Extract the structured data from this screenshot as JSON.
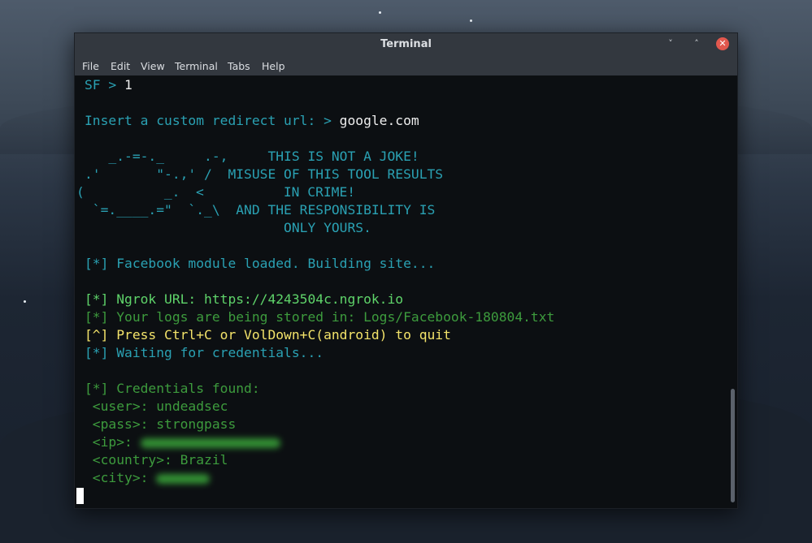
{
  "window": {
    "title": "Terminal",
    "buttons": {
      "minimize": "˅",
      "maximize": "˄",
      "close": "✕"
    }
  },
  "menubar": {
    "items": [
      "File",
      "Edit",
      "View",
      "Terminal",
      "Tabs",
      "Help"
    ]
  },
  "terminal": {
    "prompt": "SF > ",
    "prompt_input": "1",
    "redirect_prompt": "Insert a custom redirect url: > ",
    "redirect_input": "google.com",
    "ascii_art": [
      "   _.-=-._     .-,     THIS IS NOT A JOKE!",
      ".'       \"-.,' /  MISUSE OF THIS TOOL RESULTS",
      "(          _.  <          IN CRIME!",
      " `=.____.=\"  `._\\  AND THE RESPONSIBILITY IS",
      "                         ONLY YOURS."
    ],
    "module_loaded": "[*] Facebook module loaded. Building site...",
    "ngrok": "[*] Ngrok URL: https://4243504c.ngrok.io",
    "logs": "[*] Your logs are being stored in: Logs/Facebook-180804.txt",
    "quit": "[^] Press Ctrl+C or VolDown+C(android) to quit",
    "waiting": "[*] Waiting for credentials...",
    "found": "[*] Credentials found:",
    "user": " <user>: undeadsec",
    "pass": " <pass>: strongpass",
    "ip_label": " <ip>: ",
    "country": " <country>: Brazil",
    "city_label": " <city>: "
  },
  "colors": {
    "cyan": "#2aa1b3",
    "green": "#5fd46a",
    "dark_green": "#3d9b3d",
    "yellow": "#f3e36a",
    "close_button": "#e2584e"
  }
}
